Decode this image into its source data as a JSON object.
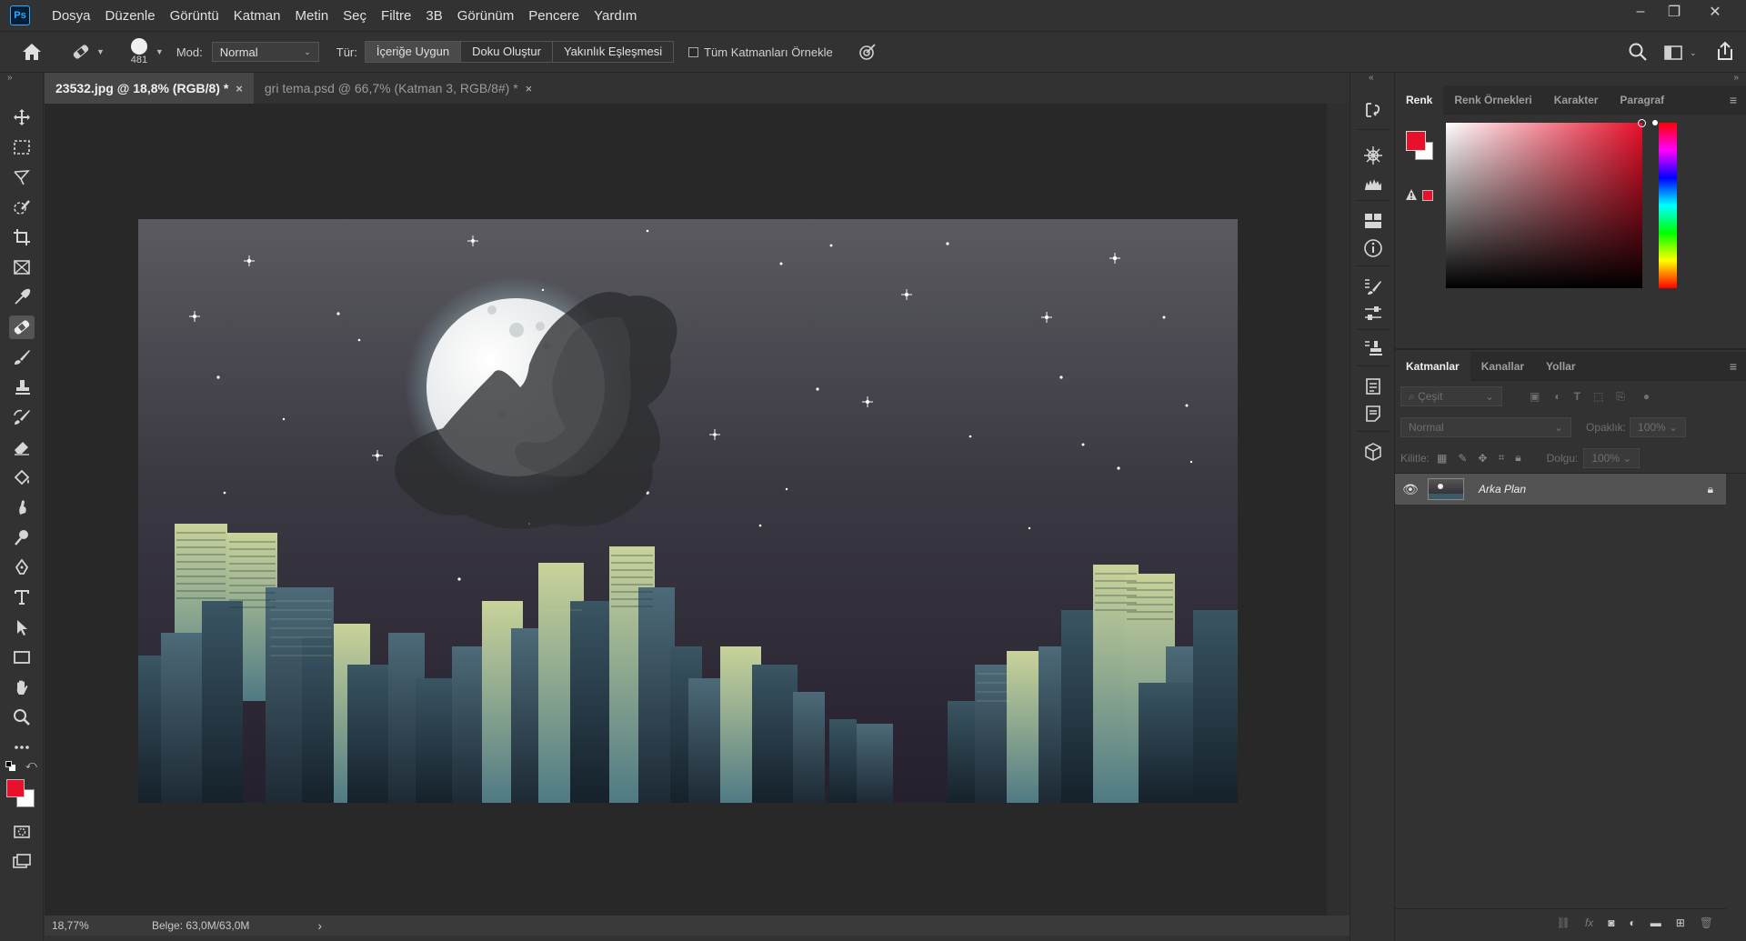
{
  "app": {
    "logo_text": "Ps",
    "accent": "#31a8ff"
  },
  "menu": [
    "Dosya",
    "Düzenle",
    "Görüntü",
    "Katman",
    "Metin",
    "Seç",
    "Filtre",
    "3B",
    "Görünüm",
    "Pencere",
    "Yardım"
  ],
  "window_controls": {
    "minimize": "‒",
    "restore": "❐",
    "close": "✕"
  },
  "options": {
    "brush_size": "481",
    "mod_label": "Mod:",
    "mod_value": "Normal",
    "tur_label": "Tür:",
    "types": [
      "İçeriğe Uygun",
      "Doku Oluştur",
      "Yakınlık Eşleşmesi"
    ],
    "sample_all_label": "Tüm Katmanları Örnekle"
  },
  "tabs": [
    {
      "label": "23532.jpg @ 18,8% (RGB/8) *",
      "close": "×"
    },
    {
      "label": "gri tema.psd @ 66,7% (Katman 3, RGB/8#) *",
      "close": "×"
    }
  ],
  "status": {
    "zoom": "18,77%",
    "doc": "Belge: 63,0M/63,0M",
    "arrow": "›"
  },
  "colors": {
    "foreground": "#e8102a",
    "background": "#ffffff"
  },
  "color_panel": {
    "tabs": [
      "Renk",
      "Renk Örnekleri",
      "Karakter",
      "Paragraf"
    ],
    "menu": "≡"
  },
  "layers_panel": {
    "tabs": [
      "Katmanlar",
      "Kanallar",
      "Yollar"
    ],
    "menu": "≡",
    "filter_placeholder": "Çeşit",
    "blend_mode": "Normal",
    "opacity_label": "Opaklık:",
    "opacity_value": "100%",
    "lock_label": "Kilitle:",
    "fill_label": "Dolgu:",
    "fill_value": "100%",
    "layers": [
      {
        "name": "Arka Plan",
        "locked": true,
        "visible": true
      }
    ]
  }
}
